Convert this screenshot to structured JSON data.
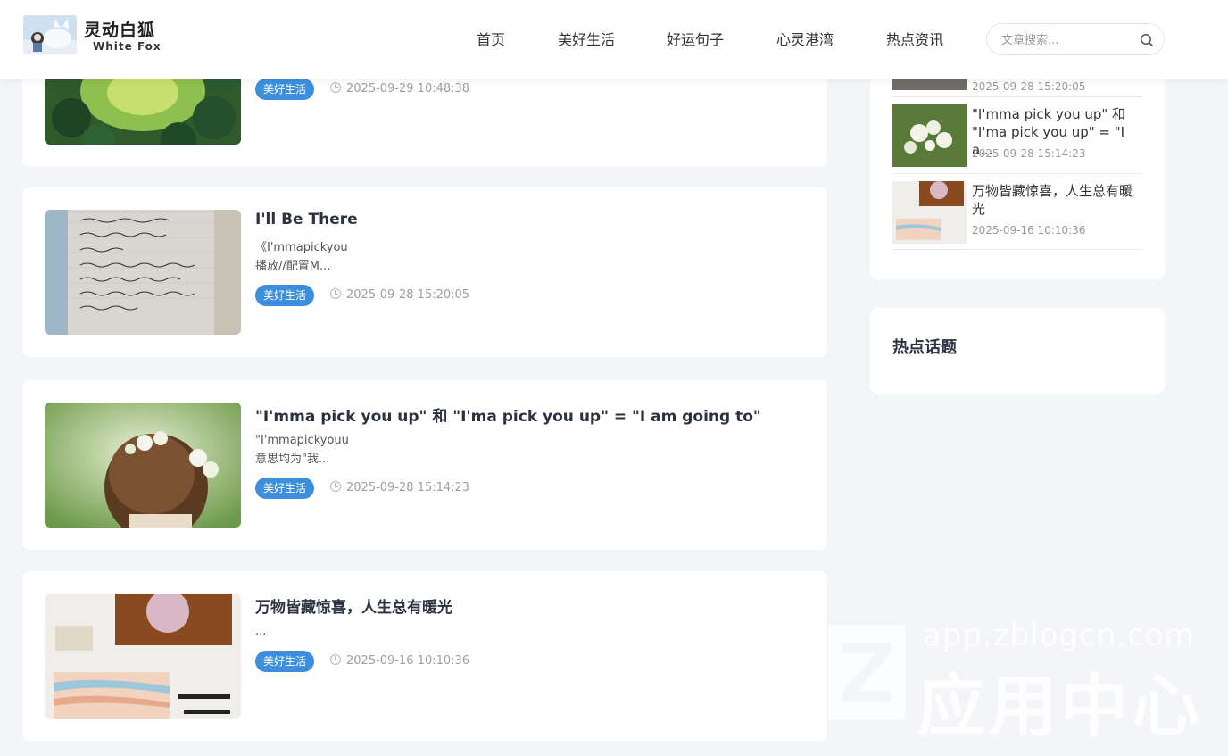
{
  "site": {
    "logo_title": "灵动白狐",
    "logo_subtitle": "White Fox"
  },
  "nav": [
    {
      "label": "首页"
    },
    {
      "label": "美好生活"
    },
    {
      "label": "好运句子"
    },
    {
      "label": "心灵港湾"
    },
    {
      "label": "热点资讯"
    }
  ],
  "search": {
    "placeholder": "文章搜索..."
  },
  "posts": [
    {
      "title": "",
      "excerpt": "",
      "tag": "美好生活",
      "date": "2025-09-29 10:48:38",
      "thumb_icon": "forest-image"
    },
    {
      "title": "I'll Be There",
      "excerpt": "《I'mmapickyou 播放//配置M...",
      "tag": "美好生活",
      "date": "2025-09-28 15:20:05",
      "thumb_icon": "handwritten-note-image"
    },
    {
      "title": "\"I'mma pick you up\" 和 \"I'ma pick you up\" = \"I am going to\"",
      "excerpt": "\"I'mmapickyouu 意思均为\"我...",
      "tag": "美好生活",
      "date": "2025-09-28 15:14:23",
      "thumb_icon": "girl-flower-crown-image"
    },
    {
      "title": "万物皆藏惊喜，人生总有暖光",
      "excerpt": "...",
      "tag": "美好生活",
      "date": "2025-09-16 10:10:36",
      "thumb_icon": "collage-image"
    }
  ],
  "sidebar": {
    "recent": [
      {
        "title": "",
        "date": "2025-09-28 15:20:05"
      },
      {
        "title": "\"I'mma pick you up\" 和 \"I'ma pick you up\" = \"I a...",
        "date": "2025-09-28 15:14:23"
      },
      {
        "title": "万物皆藏惊喜，人生总有暖光",
        "date": "2025-09-16 10:10:36"
      }
    ],
    "hot_topics_heading": "热点话题"
  },
  "watermark": {
    "url": "app.zblogcn.com",
    "text": "应用中心"
  },
  "colors": {
    "tag_bg": "#3d8fde",
    "page_bg": "#f4f5f9",
    "title": "#2a3140"
  }
}
